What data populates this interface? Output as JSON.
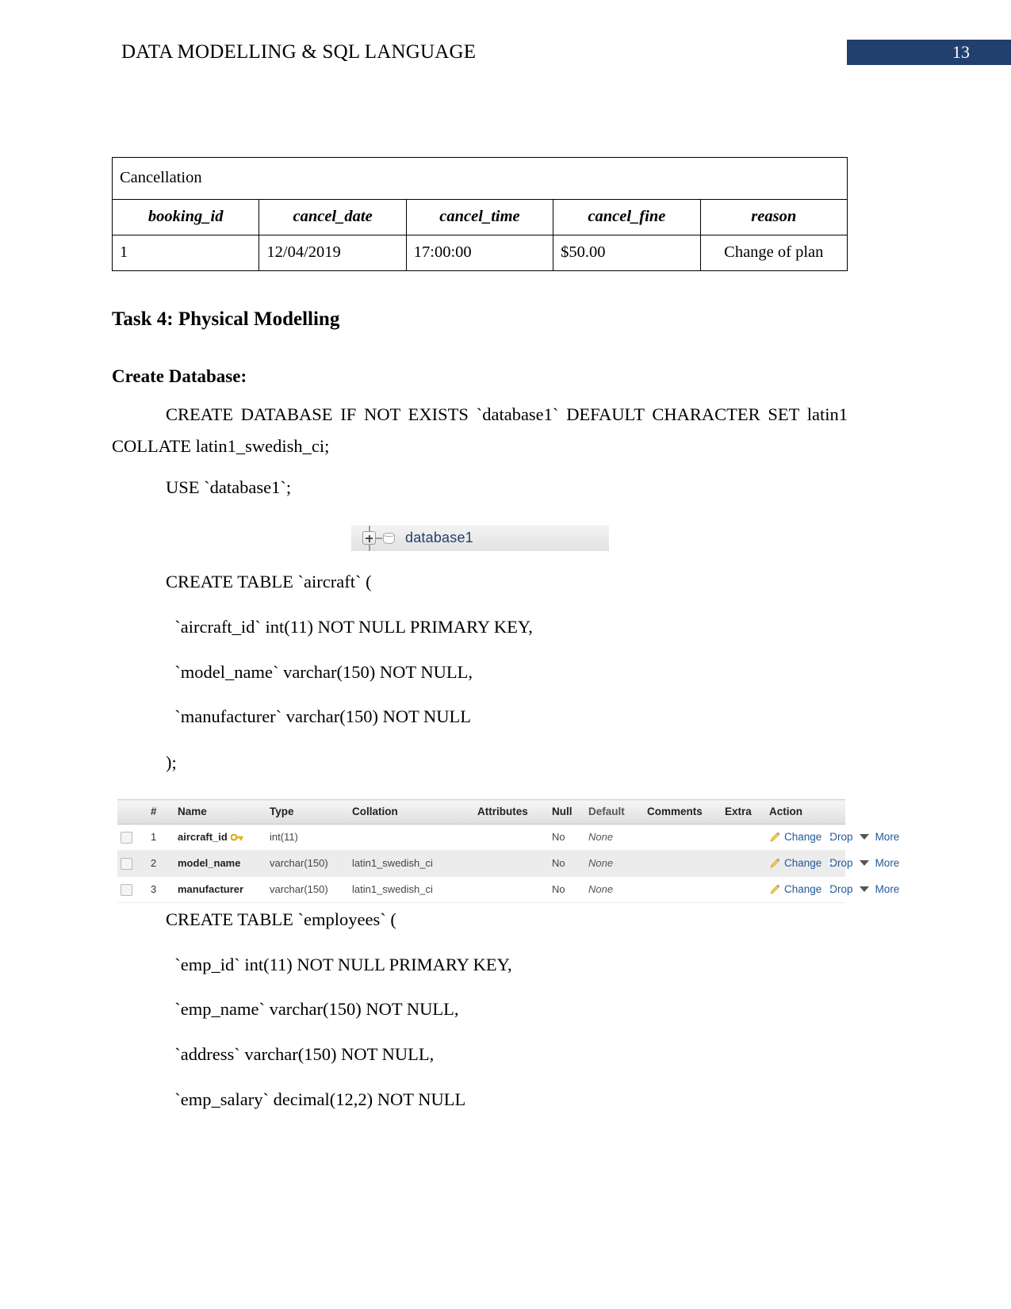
{
  "header": {
    "title": "DATA MODELLING & SQL LANGUAGE",
    "page_number": "13",
    "badge_color": "#22406d"
  },
  "cancellation_table": {
    "title": "Cancellation",
    "columns": [
      "booking_id",
      "cancel_date",
      "cancel_time",
      "cancel_fine",
      "reason"
    ],
    "rows": [
      [
        "1",
        "12/04/2019",
        "17:00:00",
        "$50.00",
        "Change of plan"
      ]
    ]
  },
  "headings": {
    "task": "Task 4: Physical Modelling",
    "create_database": "Create Database:"
  },
  "sql": {
    "create_database": "CREATE DATABASE IF NOT EXISTS `database1` DEFAULT CHARACTER SET latin1 COLLATE latin1_swedish_ci;",
    "use_database": "USE `database1`;",
    "aircraft": [
      "CREATE TABLE `aircraft` (",
      "  `aircraft_id` int(11) NOT NULL PRIMARY KEY,",
      "  `model_name` varchar(150) NOT NULL,",
      "  `manufacturer` varchar(150) NOT NULL",
      ");"
    ],
    "employees": [
      "CREATE TABLE `employees` (",
      "  `emp_id` int(11) NOT NULL PRIMARY KEY,",
      "  `emp_name` varchar(150) NOT NULL,",
      "  `address` varchar(150) NOT NULL,",
      "  `emp_salary` decimal(12,2) NOT NULL"
    ]
  },
  "tree_widget": {
    "label": "database1",
    "expand_icon": "plus-box-icon",
    "db_icon": "database-cylinder-icon"
  },
  "structure_table": {
    "columns": [
      "#",
      "Name",
      "Type",
      "Collation",
      "Attributes",
      "Null",
      "Default",
      "Comments",
      "Extra",
      "Action"
    ],
    "rows": [
      {
        "num": "1",
        "name": "aircraft_id",
        "primary_key": true,
        "type": "int(11)",
        "collation": "",
        "attributes": "",
        "null": "No",
        "default": "None",
        "comments": "",
        "extra": "",
        "actions": [
          "Change",
          "Drop",
          "More"
        ]
      },
      {
        "num": "2",
        "name": "model_name",
        "primary_key": false,
        "type": "varchar(150)",
        "collation": "latin1_swedish_ci",
        "attributes": "",
        "null": "No",
        "default": "None",
        "comments": "",
        "extra": "",
        "actions": [
          "Change",
          "Drop",
          "More"
        ]
      },
      {
        "num": "3",
        "name": "manufacturer",
        "primary_key": false,
        "type": "varchar(150)",
        "collation": "latin1_swedish_ci",
        "attributes": "",
        "null": "No",
        "default": "None",
        "comments": "",
        "extra": "",
        "actions": [
          "Change",
          "Drop",
          "More"
        ]
      }
    ],
    "link_color": "#235a97"
  }
}
